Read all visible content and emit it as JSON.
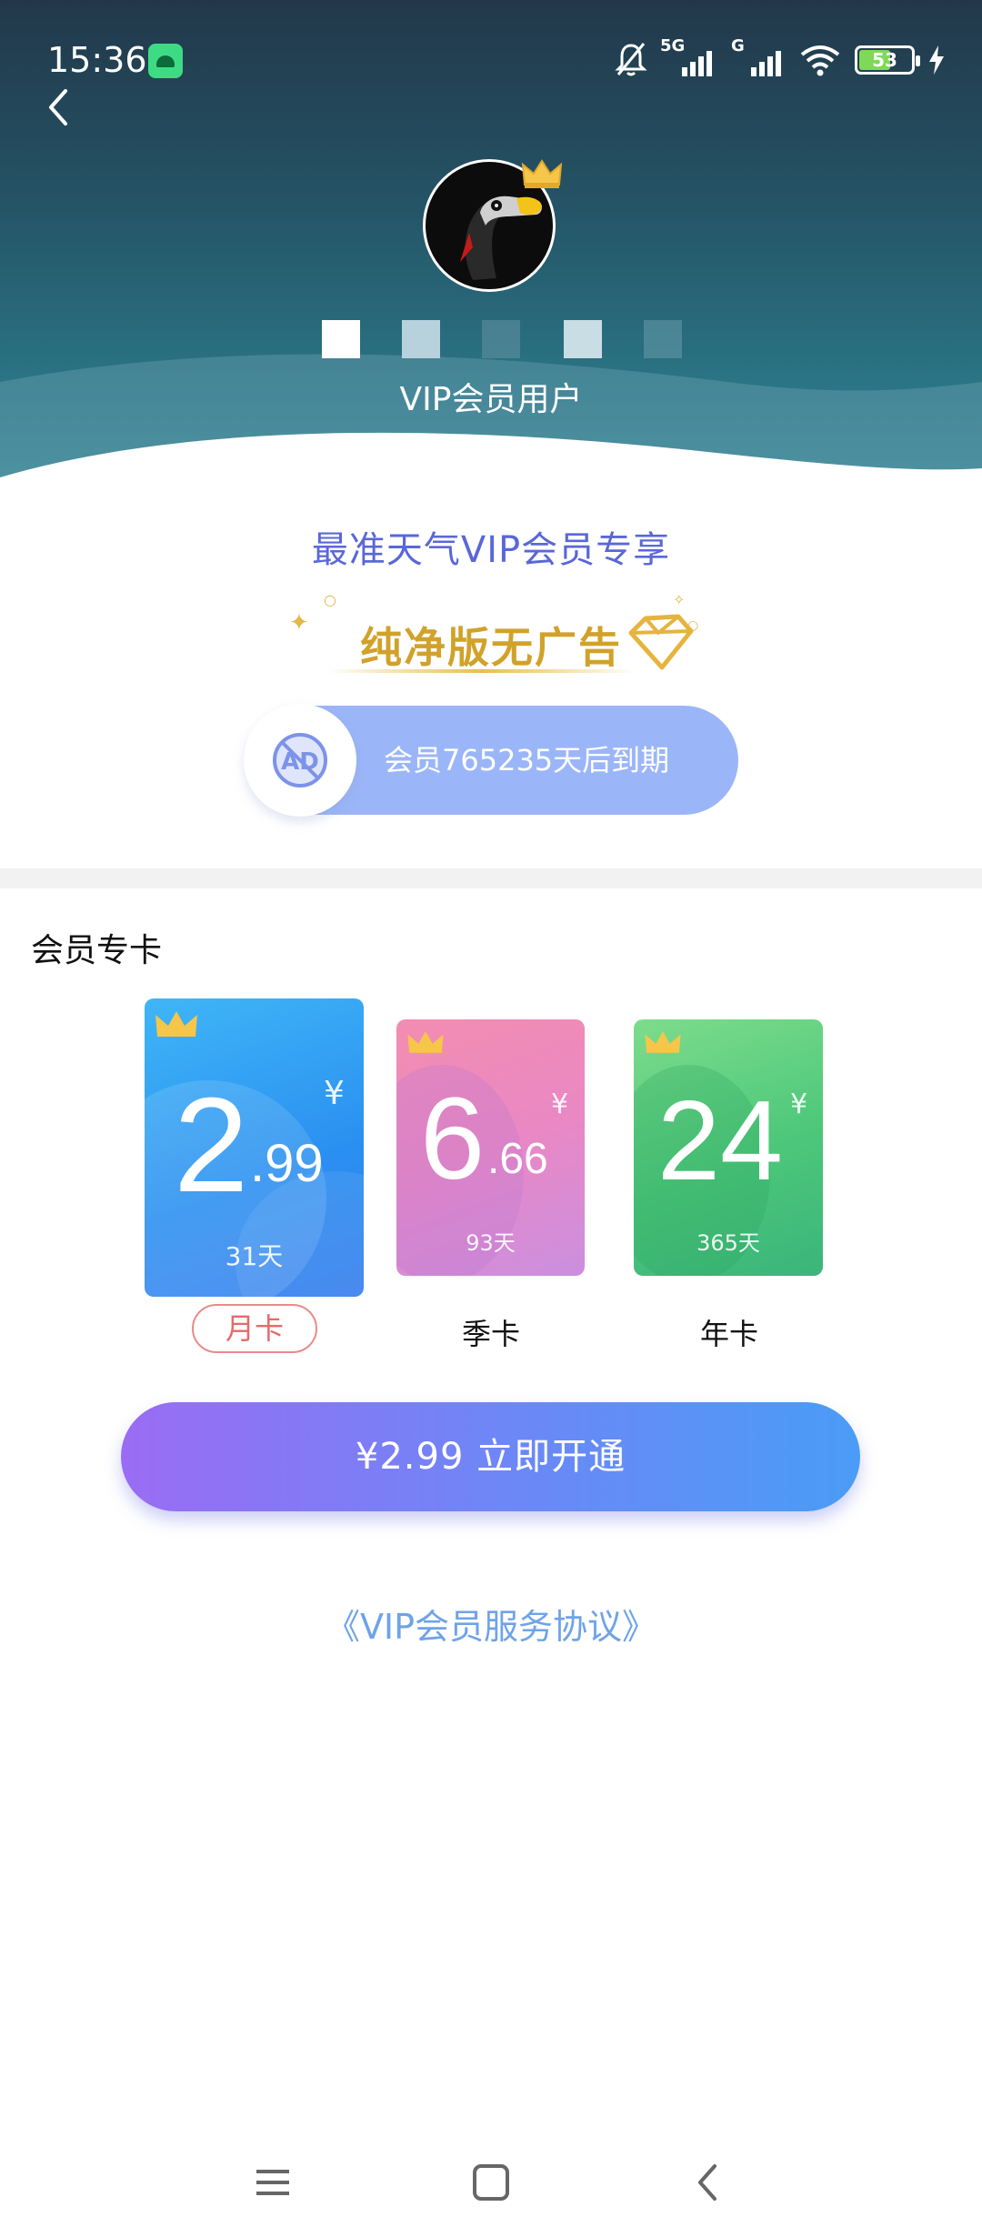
{
  "status_bar": {
    "time": "15:36",
    "network_5g": "5G",
    "network_g": "G",
    "battery": "53"
  },
  "header": {
    "user_level": "VIP会员用户"
  },
  "intro": {
    "title": "最准天气VIP会员专享",
    "benefit": "纯净版无广告",
    "expire_text": "会员765235天后到期",
    "ad_badge_text": "AD"
  },
  "section": {
    "title": "会员专卡"
  },
  "cards": [
    {
      "price_int": "2",
      "price_dec": ".99",
      "currency": "¥",
      "days": "31天",
      "label": "月卡",
      "selected": true
    },
    {
      "price_int": "6",
      "price_dec": ".66",
      "currency": "¥",
      "days": "93天",
      "label": "季卡",
      "selected": false
    },
    {
      "price_int": "24",
      "price_dec": "",
      "currency": "¥",
      "days": "365天",
      "label": "年卡",
      "selected": false
    }
  ],
  "buy_button": {
    "label": "¥2.99 立即开通"
  },
  "agreement": {
    "label": "《VIP会员服务协议》"
  },
  "colors": {
    "accent_blue": "#5a67d8",
    "gold": "#d1a22a",
    "selected_red": "#e46a6a"
  }
}
